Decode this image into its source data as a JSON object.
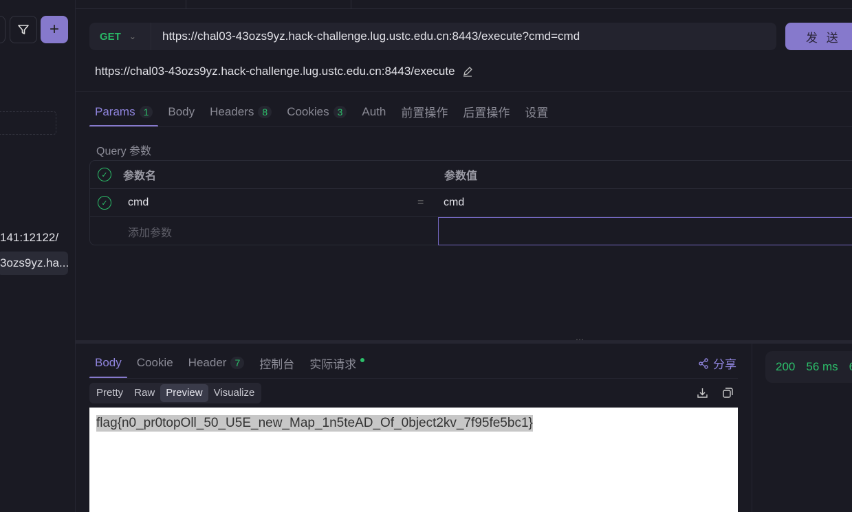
{
  "sidebar": {
    "items": [
      {
        "label": "141:12122/"
      },
      {
        "label": "3ozs9yz.ha..."
      }
    ],
    "new_button": "+"
  },
  "request": {
    "method": "GET",
    "url": "https://chal03-43ozs9yz.hack-challenge.lug.ustc.edu.cn:8443/execute?cmd=cmd",
    "send_label": "发 送",
    "name": "https://chal03-43ozs9yz.hack-challenge.lug.ustc.edu.cn:8443/execute"
  },
  "request_tabs": [
    {
      "label": "Params",
      "count": "1"
    },
    {
      "label": "Body"
    },
    {
      "label": "Headers",
      "count": "8"
    },
    {
      "label": "Cookies",
      "count": "3"
    },
    {
      "label": "Auth"
    },
    {
      "label": "前置操作"
    },
    {
      "label": "后置操作"
    },
    {
      "label": "设置"
    }
  ],
  "params": {
    "section_label": "Query 参数",
    "header_name": "参数名",
    "header_value": "参数值",
    "rows": [
      {
        "name": "cmd",
        "value": "cmd"
      }
    ],
    "add_placeholder": "添加参数",
    "equals": "="
  },
  "response_tabs": [
    {
      "label": "Body"
    },
    {
      "label": "Cookie"
    },
    {
      "label": "Header",
      "count": "7"
    },
    {
      "label": "控制台"
    },
    {
      "label": "实际请求"
    }
  ],
  "share_label": "分享",
  "view_modes": [
    "Pretty",
    "Raw",
    "Preview",
    "Visualize"
  ],
  "response_body": "flag{n0_pr0topOll_50_U5E_new_Map_1n5teAD_Of_0bject2kv_7f95fe5bc1}",
  "status": {
    "code": "200",
    "time": "56 ms",
    "size": "6"
  },
  "colors": {
    "accent": "#8679cc",
    "success": "#2cbf6a",
    "background": "#1a1a23"
  }
}
